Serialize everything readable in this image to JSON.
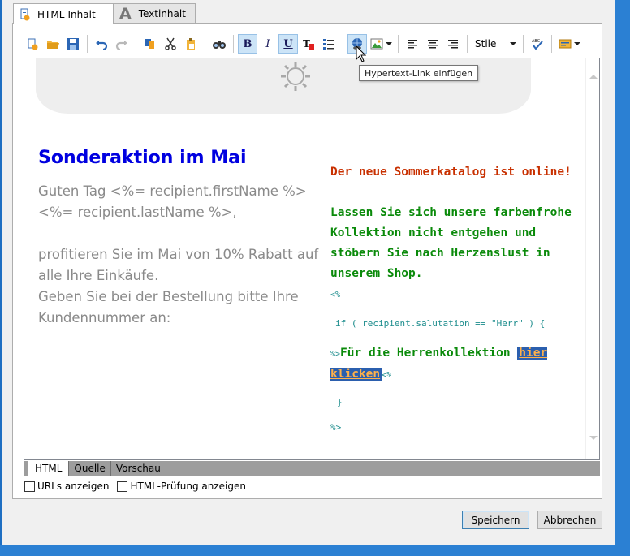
{
  "tabs": [
    {
      "label": "HTML-Inhalt",
      "active": true
    },
    {
      "label": "Textinhalt",
      "active": false
    }
  ],
  "toolbar": {
    "style_label": "Stile",
    "tooltip": "Hypertext-Link einfügen",
    "bold": "B",
    "italic": "I",
    "underline": "U"
  },
  "content": {
    "headline": "Sonderaktion im Mai",
    "greeting": "Guten Tag  <%= recipient.firstName %> <%= recipient.lastName %>,",
    "body1": "profitieren Sie im Mai von 10% Rabatt auf alle Ihre Einkäufe.",
    "body2": "Geben Sie bei der Bestellung bitte Ihre Kundennummer an:",
    "catalog": "Der neue Sommerkatalog ist online!",
    "collection": "Lassen Sie sich unsere farbenfrohe Kollektion nicht entgehen und stöbern Sie nach Herzenslust in unserem Shop.",
    "code_open": "<%",
    "code_if": "if ( recipient.salutation == \"Herr\" ) {",
    "code_close_inline": "%>",
    "herren_text": "Für die Herrenkollektion ",
    "link_text": "hier klicken",
    "code_open2": "<%",
    "code_brace": "}",
    "code_close": "%>"
  },
  "view_tabs": [
    {
      "label": "HTML",
      "active": true
    },
    {
      "label": "Quelle",
      "active": false
    },
    {
      "label": "Vorschau",
      "active": false
    }
  ],
  "options": {
    "show_urls": "URLs anzeigen",
    "html_check": "HTML-Prüfung anzeigen"
  },
  "buttons": {
    "save": "Speichern",
    "cancel": "Abbrechen"
  },
  "colors": {
    "headline": "#0000e0",
    "catalog": "#c83000",
    "collection": "#0a8a0a",
    "code": "#1b8c8c",
    "link_bg": "#2b5fae",
    "link_fg": "#ffb14a",
    "window_accent": "#2b80d3"
  }
}
